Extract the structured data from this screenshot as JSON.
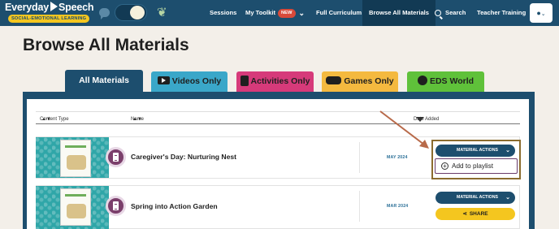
{
  "header": {
    "logo_text": "Everyday Speech",
    "logo_subtitle": "SOCIAL-EMOTIONAL LEARNING",
    "nav": [
      {
        "label": "Sessions"
      },
      {
        "label": "My Toolkit",
        "badge": "NEW"
      },
      {
        "label": "Full Curriculum"
      },
      {
        "label": "Browse All Materials",
        "active": true
      },
      {
        "label": "Search"
      },
      {
        "label": "Teacher Training"
      }
    ]
  },
  "page": {
    "title": "Browse All Materials"
  },
  "tabs": [
    {
      "label": "All Materials",
      "active": true,
      "color": "#1d4e6e"
    },
    {
      "label": "Videos Only",
      "color": "#3aa7c9"
    },
    {
      "label": "Activities Only",
      "color": "#d63a7a"
    },
    {
      "label": "Games Only",
      "color": "#f4b93f"
    },
    {
      "label": "EDS World",
      "color": "#5fc13a"
    }
  ],
  "table": {
    "columns": {
      "content_type": "Content Type",
      "name": "Name",
      "date_added": "Date Added"
    },
    "rows": [
      {
        "title": "Caregiver's Day: Nurturing Nest",
        "date": "MAY 2024",
        "actions_label": "MATERIAL ACTIONS"
      },
      {
        "title": "Spring into Action Garden",
        "date": "MAR 2024",
        "actions_label": "MATERIAL ACTIONS"
      }
    ]
  },
  "dropdown": {
    "add_to_playlist": "Add to playlist"
  },
  "share_label": "SHARE",
  "colors": {
    "nav": "#1d4e6e",
    "accent_yellow": "#f4c61f",
    "annotation": "#b86a4a"
  }
}
